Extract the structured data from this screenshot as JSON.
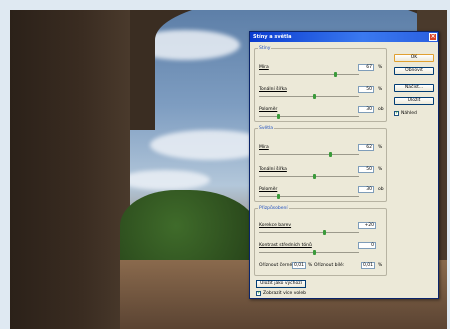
{
  "dialog": {
    "title": "Stíny a světla",
    "close_glyph": "×",
    "buttons": {
      "ok": "OK",
      "reset": "Obnovit",
      "load": "Načíst...",
      "save": "Uložit"
    },
    "preview": {
      "label": "Náhled",
      "checked": true
    }
  },
  "shadows": {
    "title": "Stíny",
    "amount": {
      "label": "Míra",
      "value": "67",
      "unit": "%",
      "level": 0.67
    },
    "tonal_width": {
      "label": "Tonální šířka",
      "value": "50",
      "unit": "%",
      "level": 0.5
    },
    "radius": {
      "label": "Poloměr",
      "value": "30",
      "unit": "ob",
      "level": 0.1
    }
  },
  "highlights": {
    "title": "Světla",
    "amount": {
      "label": "Míra",
      "value": "62",
      "unit": "%",
      "level": 0.62
    },
    "tonal_width": {
      "label": "Tonální šířka",
      "value": "50",
      "unit": "%",
      "level": 0.5
    },
    "radius": {
      "label": "Poloměr",
      "value": "30",
      "unit": "ob",
      "level": 0.1
    }
  },
  "adjustments": {
    "title": "Přizpůsobení",
    "color_correction": {
      "label": "Korekce barev",
      "value": "+20",
      "level": 0.6
    },
    "midtone_contrast": {
      "label": "Kontrast středních tónů",
      "value": "0",
      "level": 0.5
    },
    "clip_black": {
      "label": "Oříznout černé:",
      "value": "0,01",
      "unit": "%"
    },
    "clip_white": {
      "label": "Oříznout bílé:",
      "value": "0,01",
      "unit": "%"
    }
  },
  "footer": {
    "save_defaults": "Uložit jako výchozí",
    "show_more": {
      "label": "Zobrazit více voleb",
      "checked": true
    }
  },
  "colors": {
    "titlebar": "#0a3ccf",
    "dialog_bg": "#ece9d8",
    "group_title": "#2050c0",
    "slider_thumb": "#3a9a3a"
  }
}
